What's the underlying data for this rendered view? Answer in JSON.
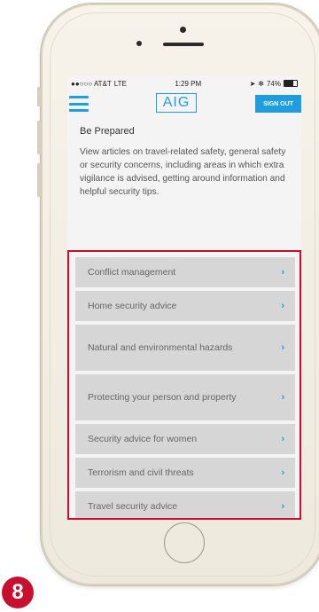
{
  "status_bar": {
    "carrier": "●●○○○ AT&T",
    "network": "LTE",
    "time": "1:29 PM",
    "battery_percent": "74%",
    "battery_level": 0.74
  },
  "header": {
    "logo_text": "AIG",
    "sign_out_label": "SIGN OUT",
    "accent_color": "#1e9ee0"
  },
  "section": {
    "title": "Be Prepared",
    "description": "View articles on travel-related safety, general safety or security concerns, including areas in which extra vigilance is advised, getting around information and helpful security tips."
  },
  "list": {
    "items": [
      {
        "label": "Conflict management"
      },
      {
        "label": "Home security advice"
      },
      {
        "label": "Natural and environmental hazards"
      },
      {
        "label": "Protecting your person and property"
      },
      {
        "label": "Security advice for women"
      },
      {
        "label": "Terrorism and civil threats"
      },
      {
        "label": "Travel security advice"
      }
    ],
    "chevron_glyph": "›",
    "highlight_color": "#c8102e"
  },
  "badge": {
    "label": "8"
  }
}
